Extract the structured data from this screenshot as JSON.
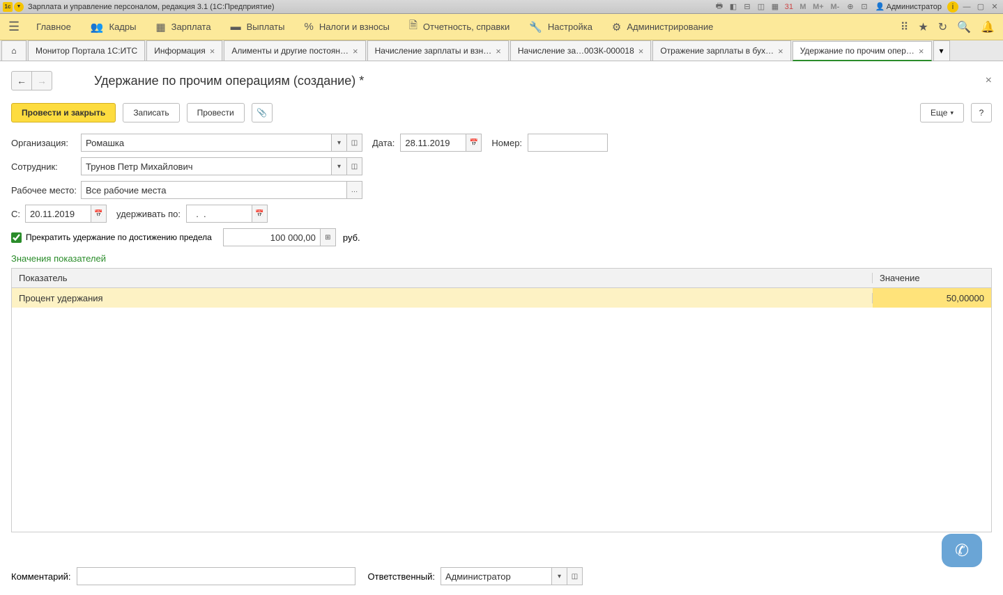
{
  "titlebar": {
    "app_title": "Зарплата и управление персоналом, редакция 3.1  (1С:Предприятие)",
    "user": "Администратор",
    "m_label": "M",
    "m_plus": "M+",
    "m_minus": "M-"
  },
  "mainmenu": {
    "items": [
      {
        "label": "Главное"
      },
      {
        "label": "Кадры"
      },
      {
        "label": "Зарплата"
      },
      {
        "label": "Выплаты"
      },
      {
        "label": "Налоги и взносы"
      },
      {
        "label": "Отчетность, справки"
      },
      {
        "label": "Настройка"
      },
      {
        "label": "Администрирование"
      }
    ]
  },
  "tabs": [
    {
      "label": "Монитор Портала 1С:ИТС"
    },
    {
      "label": "Информация"
    },
    {
      "label": "Алименты и другие постоян…"
    },
    {
      "label": "Начисление зарплаты и взн…"
    },
    {
      "label": "Начисление за…00ЗК-000018"
    },
    {
      "label": "Отражение зарплаты в бух…"
    },
    {
      "label": "Удержание по прочим опер…",
      "active": true
    }
  ],
  "page": {
    "title": "Удержание по прочим операциям (создание) *"
  },
  "toolbar": {
    "post_and_close": "Провести и закрыть",
    "write": "Записать",
    "post": "Провести",
    "more": "Еще"
  },
  "form": {
    "org_label": "Организация:",
    "org_value": "Ромашка",
    "date_label": "Дата:",
    "date_value": "28.11.2019",
    "number_label": "Номер:",
    "number_value": "",
    "employee_label": "Сотрудник:",
    "employee_value": "Трунов Петр Михайлович",
    "workplace_label": "Рабочее место:",
    "workplace_value": "Все рабочие места",
    "from_label": "С:",
    "from_value": "20.11.2019",
    "hold_to_label": "удерживать по:",
    "hold_to_value": "  .  .",
    "checkbox_label": "Прекратить удержание по достижению предела",
    "limit_value": "100 000,00",
    "currency": "руб."
  },
  "section": {
    "heading": "Значения показателей"
  },
  "table": {
    "col1": "Показатель",
    "col2": "Значение",
    "rows": [
      {
        "indicator": "Процент удержания",
        "value": "50,00000"
      }
    ]
  },
  "footer": {
    "comment_label": "Комментарий:",
    "comment_value": "",
    "responsible_label": "Ответственный:",
    "responsible_value": "Администратор"
  },
  "help": "?"
}
